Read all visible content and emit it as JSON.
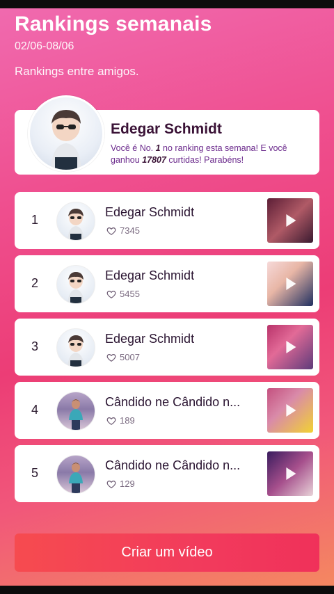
{
  "header": {
    "title": "Rankings semanais",
    "dates": "02/06-08/06",
    "subtitle": "Rankings entre amigos."
  },
  "hero": {
    "name": "Edegar Schmidt",
    "msg_part1": "Você é No. ",
    "rank": "1",
    "msg_part2": " no ranking esta semana! E você ganhou ",
    "likes": "17807",
    "msg_part3": " curtidas! Parabéns!"
  },
  "rankings": [
    {
      "rank": "1",
      "name": "Edegar Schmidt",
      "likes": "7345"
    },
    {
      "rank": "2",
      "name": "Edegar Schmidt",
      "likes": "5455"
    },
    {
      "rank": "3",
      "name": "Edegar Schmidt",
      "likes": "5007"
    },
    {
      "rank": "4",
      "name": "Cândido ne Cândido n...",
      "likes": "189"
    },
    {
      "rank": "5",
      "name": "Cândido ne Cândido n...",
      "likes": "129"
    }
  ],
  "cta": {
    "label": "Criar um vídeo"
  },
  "colors": {
    "accent": "#f23b5c",
    "name_text": "#3a1236",
    "message_text": "#6b2a8c"
  }
}
